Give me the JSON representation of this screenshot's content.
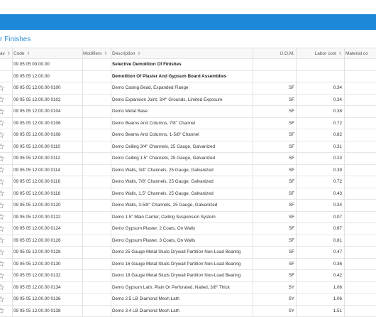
{
  "section_title": "r Finishes",
  "headers": {
    "fav": "av",
    "code": "Code",
    "modifiers": "Modifiers",
    "description": "Description",
    "uom": "U.O.M.",
    "labor": "Labor cost",
    "material": "Material co"
  },
  "rows": [
    {
      "code": "09 05 05 00.00.00",
      "modifiers": "",
      "description": "Selective Demolition Of Finishes",
      "uom": "",
      "labor": "",
      "bold": true,
      "star": false
    },
    {
      "code": "09 05 05 12.00.00",
      "modifiers": "",
      "description": "Demolition Of Plaster And Gypsum Board Assemblies",
      "uom": "",
      "labor": "",
      "bold": true,
      "star": false
    },
    {
      "code": "09 05 05 12.00.00 0100",
      "modifiers": "",
      "description": "Demo Casing Bead, Expanded Flange",
      "uom": "SF",
      "labor": "0.34",
      "bold": false,
      "star": true
    },
    {
      "code": "09 05 05 12.00.00 0102",
      "modifiers": "",
      "description": "Demo Expansion Joint, 3/4\" Grounds, Limited Exposure",
      "uom": "SF",
      "labor": "0.34",
      "bold": false,
      "star": true
    },
    {
      "code": "09 05 05 12.00.00 0104",
      "modifiers": "",
      "description": "Demo Metal Base",
      "uom": "SF",
      "labor": "0.38",
      "bold": false,
      "star": true
    },
    {
      "code": "09 05 05 12.00.00 0106",
      "modifiers": "",
      "description": "Demo Beams And Columns, 7/8\" Channel",
      "uom": "SF",
      "labor": "0.72",
      "bold": false,
      "star": true
    },
    {
      "code": "09 05 05 12.00.00 0108",
      "modifiers": "",
      "description": "Demo Beams And Columns, 1-5/8\" Channel",
      "uom": "SF",
      "labor": "0.82",
      "bold": false,
      "star": true
    },
    {
      "code": "09 05 05 12.00.00 0110",
      "modifiers": "",
      "description": "Demo Ceiling 3/4\" Channels, 25 Gauge, Galvanized",
      "uom": "SF",
      "labor": "0.31",
      "bold": false,
      "star": true
    },
    {
      "code": "09 05 05 12.00.00 0112",
      "modifiers": "",
      "description": "Demo Ceiling 1.5\" Channels, 25 Gauge, Galvanized",
      "uom": "SF",
      "labor": "0.23",
      "bold": false,
      "star": true
    },
    {
      "code": "09 05 05 12.00.00 0114",
      "modifiers": "",
      "description": "Demo Walls, 3/4\" Channels, 25 Gauge, Galvanized",
      "uom": "SF",
      "labor": "0.39",
      "bold": false,
      "star": true
    },
    {
      "code": "09 05 05 12.00.00 0116",
      "modifiers": "",
      "description": "Demo Walls, 7/8\" Channels, 25 Gauge, Galvanized",
      "uom": "SF",
      "labor": "0.72",
      "bold": false,
      "star": true
    },
    {
      "code": "09 05 05 12.00.00 0118",
      "modifiers": "",
      "description": "Demo Walls, 1.5\" Channels, 25 Gauge, Galvanized",
      "uom": "SF",
      "labor": "0.43",
      "bold": false,
      "star": true
    },
    {
      "code": "09 05 05 12.00.00 0120",
      "modifiers": "",
      "description": "Demo Walls, 3-5/8\" Channels, 25 Gauge, Galvanized",
      "uom": "SF",
      "labor": "0.34",
      "bold": false,
      "star": true
    },
    {
      "code": "09 05 05 12.00.00 0122",
      "modifiers": "",
      "description": "Demo 1.5\" Main Carrier, Ceiling Suspension System",
      "uom": "SF",
      "labor": "0.07",
      "bold": false,
      "star": true
    },
    {
      "code": "09 05 05 12.00.00 0124",
      "modifiers": "",
      "description": "Demo Gypsum Plaster, 2 Coats, On Walls",
      "uom": "SF",
      "labor": "0.67",
      "bold": false,
      "star": true
    },
    {
      "code": "09 05 05 12.00.00 0126",
      "modifiers": "",
      "description": "Demo Gypsum Plaster, 3 Coats, On Walls",
      "uom": "SF",
      "labor": "0.81",
      "bold": false,
      "star": true
    },
    {
      "code": "09 05 05 12.00.00 0128",
      "modifiers": "",
      "description": "Demo 25 Gauge Metal Studs Drywall Partition Non-Load Bearing",
      "uom": "SF",
      "labor": "0.47",
      "bold": false,
      "star": true
    },
    {
      "code": "09 05 05 12.00.00 0130",
      "modifiers": "",
      "description": "Demo 16 Gauge Metal Studs Drywall Partition Non-Load Bearing",
      "uom": "SF",
      "labor": "0.36",
      "bold": false,
      "star": true
    },
    {
      "code": "09 05 05 12.00.00 0132",
      "modifiers": "",
      "description": "Demo 18 Gauge Metal Studs Drywall Partition Non-Load Bearing",
      "uom": "SF",
      "labor": "0.42",
      "bold": false,
      "star": true
    },
    {
      "code": "09 05 05 12.00.00 0134",
      "modifiers": "",
      "description": "Demo Gypsum Lath, Plain Or Perforated, Nailed, 3/8\" Thick",
      "uom": "SY",
      "labor": "1.06",
      "bold": false,
      "star": true
    },
    {
      "code": "09 05 05 12.00.00 0136",
      "modifiers": "",
      "description": "Demo 2.5 LB Diamond Mesh Lath",
      "uom": "SY",
      "labor": "1.06",
      "bold": false,
      "star": true
    },
    {
      "code": "09 05 05 12.00.00 0138",
      "modifiers": "",
      "description": "Demo 3.4 LB Diamond Mesh Lath",
      "uom": "SY",
      "labor": "1.51",
      "bold": false,
      "star": true
    }
  ]
}
